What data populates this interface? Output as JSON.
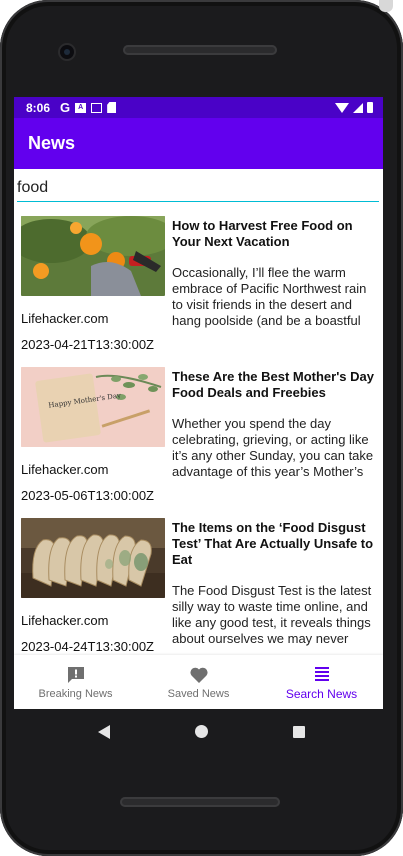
{
  "status": {
    "time": "8:06",
    "g": "G",
    "a": "A"
  },
  "app": {
    "title": "News"
  },
  "search": {
    "value": "food",
    "placeholder": ""
  },
  "articles": [
    {
      "title": "How to Harvest Free Food on Your Next Vacation",
      "description": "Occasionally, I’ll flee the warm embrace of Pacific Northwest rain to visit friends in the desert and hang poolside (and be a boastful dick about it on Instagram). Most p…",
      "source": "Lifehacker.com",
      "date": "2023-04-21T13:30:00Z"
    },
    {
      "title": "These Are the Best Mother's Day Food Deals and Freebies",
      "description": "Whether you spend the day celebrating, grieving, or acting like it’s any other Sunday, you can take advantage of this year’s Mother’s Day food deals and freebies, like t…",
      "source": "Lifehacker.com",
      "date": "2023-05-06T13:00:00Z",
      "thumb_text": "Happy Mother's Day"
    },
    {
      "title": "The Items on the ‘Food Disgust Test’ That Are Actually Unsafe to Eat",
      "description": "The Food Disgust Test is the latest silly way to waste time online, and like any good test, it reveals things about ourselves we may never have thought to question. Is it gross to b…",
      "source": "Lifehacker.com",
      "date": "2023-04-24T13:30:00Z"
    }
  ],
  "nav": {
    "breaking": "Breaking News",
    "saved": "Saved News",
    "search": "Search News"
  },
  "colors": {
    "primary": "#6200ee",
    "status_bar": "#4a02c7",
    "accent_underline": "#00bcd4",
    "nav_inactive": "#6f6f6f"
  }
}
